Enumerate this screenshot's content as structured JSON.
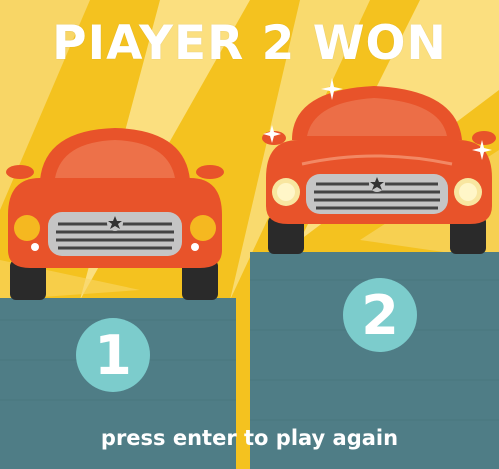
{
  "title": "PIAYER 2 WON",
  "prompt": "press enter to play again",
  "podium": {
    "first": {
      "rank_label": "1"
    },
    "second": {
      "rank_label": "2"
    }
  },
  "colors": {
    "background": "#f4c21f",
    "ray": "#fbe490",
    "podium": "#4d7b84",
    "car_body": "#e8532a",
    "grille": "#b9b9b9",
    "badge": "#7ccccc",
    "text": "#ffffff"
  },
  "icons": {
    "car_left": "red-car-icon",
    "car_right": "red-car-icon",
    "sparkles": "sparkle-icon",
    "star_emblem": "star-icon"
  }
}
